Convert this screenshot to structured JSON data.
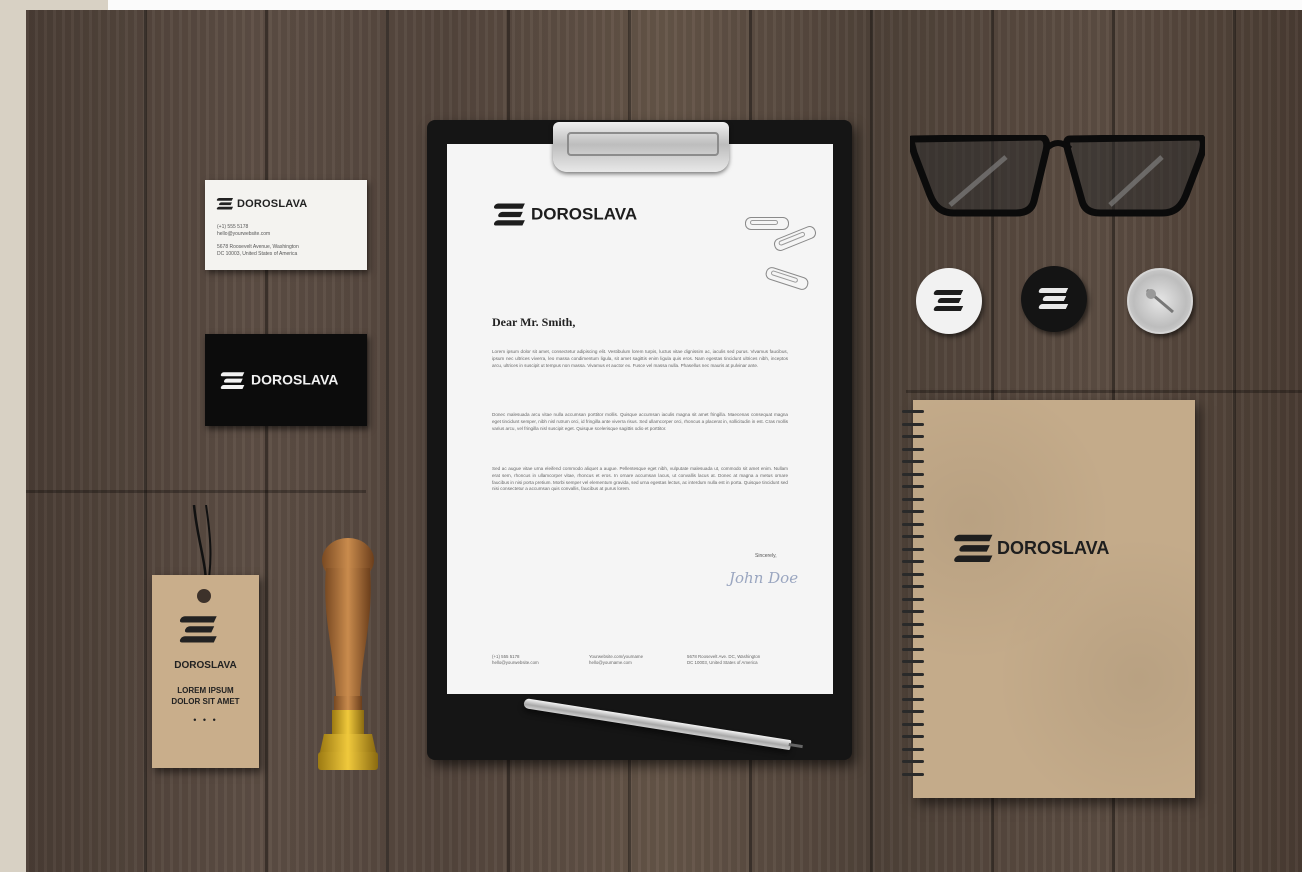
{
  "brand": {
    "name": "DOROSLAVA",
    "accent": "#1d1d1d"
  },
  "business_card_white": {
    "brand": "DOROSLAVA",
    "lines": [
      "(+1) 555 5178",
      "hello@yourwebsite.com",
      "5678 Roosevelt Avenue, Washington",
      "DC 10003, United States of America"
    ]
  },
  "business_card_black": {
    "brand": "DOROSLAVA"
  },
  "letter": {
    "brand": "DOROSLAVA",
    "salutation": "Dear Mr. Smith,",
    "paragraphs": [
      "Lorem ipsum dolor sit amet, consectetur adipiscing elit. Vestibulum lorem turpis, luctus vitae dignissim ac, iaculis sed purus. Vivamus faucibus, ipsum nec ultrices viverra, leo massa condimentum ligula, sit amet sagittis enim ligula quis eros. Nam egestas tincidunt ultrices nibh, inceptos arcu, ultrices in suscipit ut tempus non massa. Vivamus et auctor ex. Fusce vel massa nulla. Phasellus nec mauris at pulvinar ante.",
      "Donec malesuada arcu vitae nulla accumsan porttitor mollis. Quisque accumsan iaculis magna sit amet fringilla. Maecenas consequat magna eget tincidunt semper, nibh nisl rutrum orci, id fringilla ante viverra risus. Sed ullamcorper orci, rhoncus a placerat in, sollicitudin in est. Cras mollis varius arcu, vel fringilla nisl suscipit eget. Quisque scelerisque sagittis odio et porttitor.",
      "Sed ac augue vitae urna eleifend commodo aliquet a augue. Pellentesque eget nibh, vulputate malesuada ut, commodo sit amet enim. Nullam erat sem, rhoncus in ullamcorper vitae, rhoncus et eros. In ornare accumsan lacus, ut convallis lacus at. Donec at magna a metus ornare faucibus in nisi porta pretium. Morbi semper vel elementum gravida, sed urna egestas lectus, ac interdum nulla est in porta. Quisque tincidunt sed nisi consectetur a accumsan quis convallis, faucibus at purus lorem."
    ],
    "closing": "Sincerely,",
    "signature": "John Doe",
    "footer": [
      [
        "(+1) 555 5178",
        "hello@yourwebsite.com"
      ],
      [
        "Yourwebsite.com/yourname",
        "hello@yourname.com"
      ],
      [
        "5678 Roosevelt Ave. DC, Washington",
        "DC 10003, United States of America"
      ]
    ]
  },
  "notebook": {
    "brand": "DOROSLAVA"
  },
  "hang_tag": {
    "brand": "DOROSLAVA",
    "slogan_line1": "LOREM IPSUM",
    "slogan_line2": "DOLOR SIT AMET",
    "dots": "• • •"
  },
  "badges": [
    {
      "name": "white",
      "color": "#f2f2f2",
      "logo_color": "#1d1d1d"
    },
    {
      "name": "black",
      "color": "#141414",
      "logo_color": "#e8e8e8"
    },
    {
      "name": "pin-back",
      "color": "#cfcfcf",
      "logo_color": "none"
    }
  ],
  "icons": [
    "logo-mark-icon",
    "paperclip-icon",
    "pen-icon",
    "glasses-icon",
    "stamp-icon"
  ]
}
